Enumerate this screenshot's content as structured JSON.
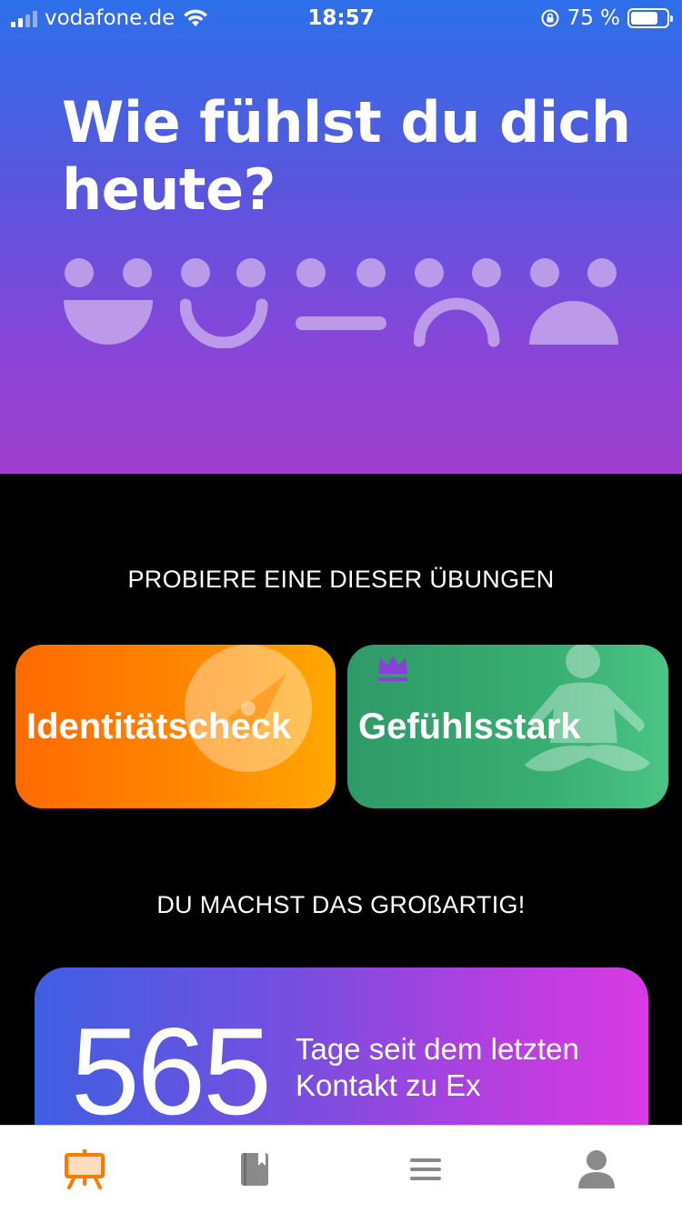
{
  "status_bar": {
    "carrier": "vodafone.de",
    "time": "18:57",
    "battery": "75 %",
    "battery_level": 0.75
  },
  "hero": {
    "title_line1": "Wie fühlst du dich",
    "title_line2": "heute?",
    "moods": [
      "very-happy-face-icon",
      "happy-face-icon",
      "neutral-face-icon",
      "sad-face-icon",
      "very-sad-face-icon"
    ]
  },
  "exercises": {
    "heading": "PROBIERE EINE DIESER ÜBUNGEN",
    "items": [
      {
        "label": "Identitätscheck",
        "icon": "compass-icon",
        "color": "#ff7a00"
      },
      {
        "label": "Gefühlsstark",
        "icon": "meditation-icon",
        "badge": "crown-icon",
        "color": "#3aaa72"
      }
    ]
  },
  "progress": {
    "heading": "DU MACHST DAS GROßARTIG!",
    "counter_value": "565",
    "counter_label": "Tage seit dem letzten Kontakt zu Ex"
  },
  "tab_bar": {
    "tabs": [
      "dashboard-icon",
      "journal-icon",
      "menu-icon",
      "profile-icon"
    ],
    "active_color": "#ff7a00",
    "inactive_color": "#8a8a8a"
  }
}
